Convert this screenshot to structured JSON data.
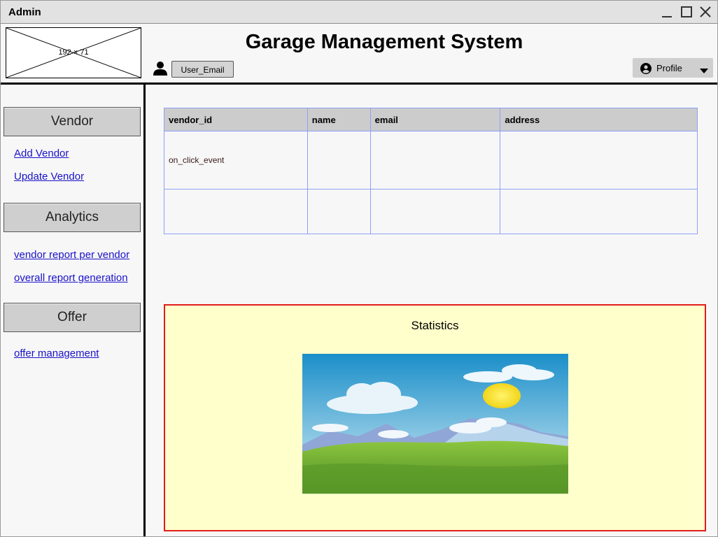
{
  "window": {
    "title": "Admin"
  },
  "header": {
    "logo_placeholder": "192 × 71",
    "title": "Garage Management System",
    "user_email": "User_Email",
    "profile_label": "Profile"
  },
  "sidebar": {
    "sections": [
      {
        "title": "Vendor",
        "links": [
          "Add Vendor",
          "Update Vendor"
        ]
      },
      {
        "title": "Analytics",
        "links": [
          "vendor report per vendor",
          "overall report generation"
        ]
      },
      {
        "title": "Offer",
        "links": [
          "offer management"
        ]
      }
    ]
  },
  "table": {
    "columns": [
      "vendor_id",
      "name",
      "email",
      "address"
    ],
    "rows": [
      [
        "on_click_event",
        "",
        "",
        ""
      ],
      [
        "",
        "",
        "",
        ""
      ]
    ]
  },
  "statistics": {
    "title": "Statistics"
  },
  "colors": {
    "link": "#1a12c9",
    "table_border": "#8ea0f5",
    "stats_bg": "#ffffcc",
    "stats_border": "#e11c1c"
  }
}
